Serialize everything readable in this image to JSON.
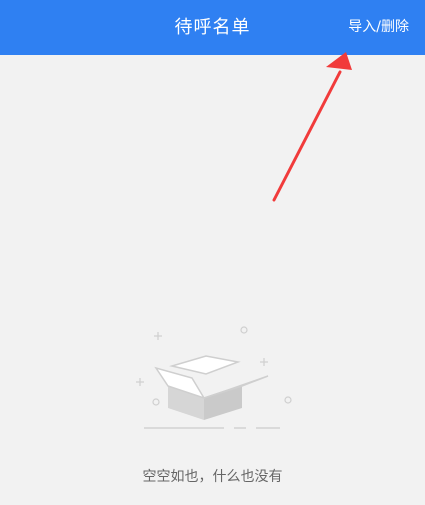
{
  "header": {
    "title": "待呼名单",
    "action_label": "导入/删除",
    "background_color": "#2f80f2"
  },
  "annotation": {
    "arrow_color": "#f13b3b"
  },
  "empty_state": {
    "icon": "empty-box-icon",
    "message": "空空如也，什么也没有"
  }
}
